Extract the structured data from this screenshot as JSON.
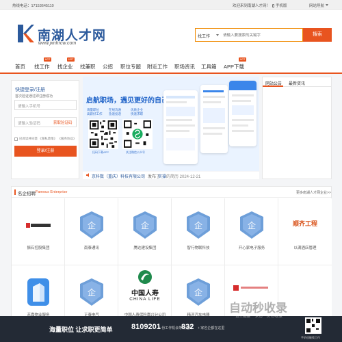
{
  "topbar": {
    "hotline": "热线电话：17153645110",
    "welcome": "欢迎来到南湖人才网！",
    "mobile": "手机版",
    "site_nav": "网站导航"
  },
  "logo": {
    "title": "南湖人才网",
    "url": "www.jxnhrcw.com"
  },
  "search": {
    "category": "找工作",
    "placeholder": "请输入要搜索的关键字",
    "button": "搜索"
  },
  "nav": {
    "items": [
      {
        "label": "首页"
      },
      {
        "label": "找工作",
        "badge": "HOT"
      },
      {
        "label": "找企业",
        "badge": "HOT"
      },
      {
        "label": "找兼职"
      },
      {
        "label": "公招"
      },
      {
        "label": "职位专题"
      },
      {
        "label": "附近工作"
      },
      {
        "label": "职场资讯"
      },
      {
        "label": "工具箱"
      },
      {
        "label": "APP下载",
        "badge": "HOT"
      }
    ]
  },
  "login": {
    "title": "快捷登录/注册",
    "subtitle": "首次验证通过即注册成功",
    "phone_placeholder": "请输入手机号",
    "code_placeholder": "请输入验证码",
    "get_code": "获取验证码",
    "agreement": "已阅读并同意 《隐私政策》 《服务协议》",
    "submit": "登录/注册"
  },
  "banner": {
    "headline": "启航职场，遇见更好的自己",
    "features": [
      "海量职位",
      "在线沟通",
      "优质企业",
      "高薪好工作",
      "急速投递",
      "快速求职"
    ],
    "qr_captions": [
      "扫码下载APP",
      "关注微信公众号"
    ]
  },
  "company_line": {
    "company": "京科数（重庆）科技有限公司",
    "status": "发布了",
    "job": "实操",
    "date": "的简历 2024-12-21"
  },
  "notice": {
    "tabs": [
      "网站公告",
      "最新资讯"
    ]
  },
  "famous": {
    "title": "名企招聘",
    "subtitle": "Famous Enterprise",
    "more": "更多南湖人才网企业>>",
    "companies": [
      {
        "name": "振石控股集团",
        "logo": "zhenshi"
      },
      {
        "name": "南泰通讯",
        "logo": "qi"
      },
      {
        "name": "腾达建设集团",
        "logo": "qi"
      },
      {
        "name": "智行物联科技",
        "logo": "qi"
      },
      {
        "name": "开心家电子服务",
        "logo": "qi"
      },
      {
        "name": "以满酒店管理",
        "logo": "shunqi"
      },
      {
        "name": "苏嘉物业服务",
        "logo": "building"
      },
      {
        "name": "正泰电气",
        "logo": "qi"
      },
      {
        "name": "中国人寿保险嘉兴分公司",
        "logo": "chinalife"
      },
      {
        "name": "精河汽车电器",
        "logo": "qi"
      },
      {
        "name": "",
        "logo": "red"
      },
      {
        "name": "",
        "logo": "blank"
      }
    ],
    "logo_texts": {
      "shunqi": "顺齐工程",
      "chinalife_cn": "中国人寿",
      "chinalife_en": "CHINA LIFE"
    }
  },
  "bottom_bar": {
    "slogan": "海量职位 让求职更简单",
    "jobs_count": "8109201",
    "jobs_label": "+ 份工作机会等你选择",
    "companies_count": "832",
    "companies_label": "+ 家名企都在这里",
    "app_caption": "手机也能找工作"
  },
  "watermark": {
    "big": "自动秒收录",
    "small": "设上链接 一来访一次 秒收录"
  },
  "colors": {
    "accent": "#e8541f",
    "brand_blue": "#2c5a9c",
    "bottom_bar": "#232a35"
  }
}
